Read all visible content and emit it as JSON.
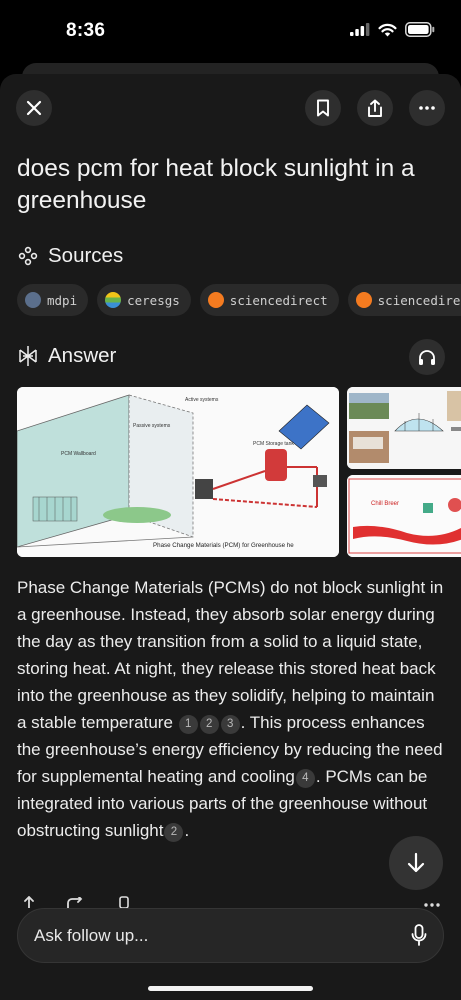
{
  "status_bar": {
    "time": "8:36"
  },
  "query": "does pcm for heat block sunlight in a greenhouse",
  "sources": {
    "label": "Sources",
    "items": [
      {
        "name": "mdpi",
        "icon": "mdpi-favicon",
        "color": "#5b6f8c"
      },
      {
        "name": "ceresgs",
        "icon": "ceresgs-favicon",
        "color": "#f0c419"
      },
      {
        "name": "sciencedirect",
        "icon": "sciencedirect-favicon",
        "color": "#f47b20"
      },
      {
        "name": "sciencedirect",
        "icon": "sciencedirect-favicon",
        "color": "#f47b20"
      }
    ]
  },
  "answer": {
    "label": "Answer",
    "images": {
      "main_caption": "Phase Change Materials (PCM) for Greenhouse he",
      "side2_caption": "Chill Breer"
    },
    "segments": [
      {
        "type": "text",
        "value": "Phase Change Materials (PCMs) do not block sunlight in a greenhouse. Instead, they absorb solar energy during the day as they transition from a solid to a liquid state, storing heat. At night, they release this stored heat back into the greenhouse as they solidify, helping to maintain a stable temperature"
      },
      {
        "type": "cite",
        "value": "1"
      },
      {
        "type": "cite",
        "value": "2"
      },
      {
        "type": "cite",
        "value": "3"
      },
      {
        "type": "text",
        "value": ". This process enhances the greenhouse’s energy efficiency by reducing the need for supplemental heating and cooling"
      },
      {
        "type": "cite",
        "value": "4"
      },
      {
        "type": "text",
        "value": ". PCMs can be integrated into various parts of the greenhouse without obstructing sunlight"
      },
      {
        "type": "cite",
        "value": "2"
      },
      {
        "type": "text",
        "value": "."
      }
    ]
  },
  "followup": {
    "placeholder": "Ask follow up..."
  },
  "colors": {
    "background": "#191919",
    "chip": "#2a2a2a",
    "text": "#ececec"
  }
}
